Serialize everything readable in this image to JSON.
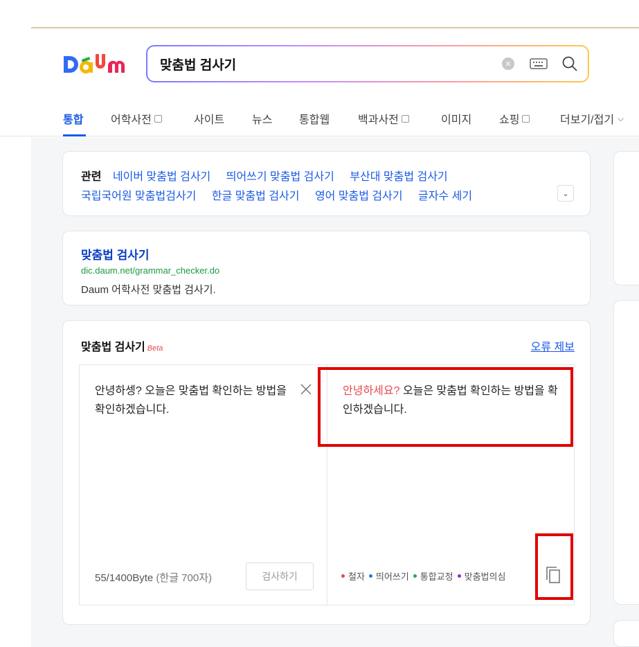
{
  "search": {
    "query": "맞춤법 검사기",
    "clear_icon": "close-circle-icon",
    "keyboard_icon": "keyboard-icon",
    "search_icon": "magnifier-icon"
  },
  "logo": {
    "text": "Daum"
  },
  "tabs": [
    {
      "label": "통합",
      "active": true
    },
    {
      "label": "어학사전",
      "box": true
    },
    {
      "label": "사이트"
    },
    {
      "label": "뉴스"
    },
    {
      "label": "통합웹"
    },
    {
      "label": "백과사전",
      "box": true
    },
    {
      "label": "이미지"
    },
    {
      "label": "쇼핑",
      "box": true
    },
    {
      "label": "더보기/접기",
      "chevron": "⌵"
    }
  ],
  "related": {
    "label": "관련",
    "row1": [
      "네이버 맞춤법 검사기",
      "띄어쓰기 맞춤법 검사기",
      "부산대 맞춤법 검사기"
    ],
    "row2": [
      "국립국어원 맞춤법검사기",
      "한글 맞춤법 검사기",
      "영어 맞춤법 검사기",
      "글자수 세기"
    ],
    "expand": "⌄"
  },
  "result": {
    "title": "맞춤법 검사기",
    "url": "dic.daum.net/grammar_checker.do",
    "desc": "Daum 어학사전 맞춤법 검사기."
  },
  "checker": {
    "title": "맞춤법 검사기",
    "beta": "Beta",
    "report": "오류 제보",
    "input_text": "안녕하셍? 오늘은 맞춤법 확인하는 방법을 확인하겠습니다.",
    "byte_count": "55/1400Byte",
    "byte_sub": "(한글 700자)",
    "check_button": "검사하기",
    "output_error": "안녕하세요?",
    "output_rest": " 오늘은 맞춤법 확인하는 방법을 확인하겠습니다.",
    "legend": [
      {
        "label": "철자",
        "color": "#e8484b"
      },
      {
        "label": "띄어쓰기",
        "color": "#1a7ae6"
      },
      {
        "label": "통합교정",
        "color": "#1fae4b"
      },
      {
        "label": "맞춤법의심",
        "color": "#8a2be2"
      }
    ]
  },
  "colors": {
    "accent": "#1a5ae6",
    "highlight": "#e00000",
    "error_text": "#e8484b"
  }
}
